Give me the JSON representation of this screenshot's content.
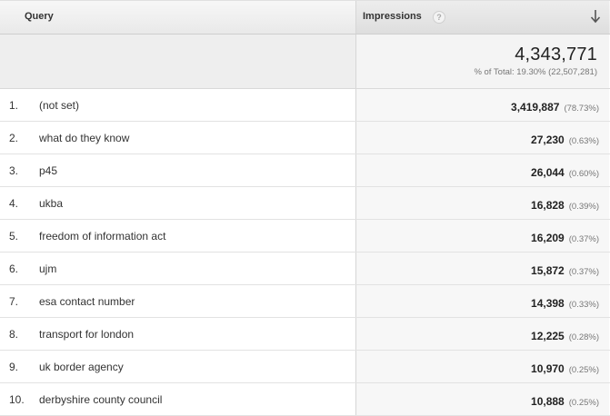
{
  "header": {
    "query_label": "Query",
    "impressions_label": "Impressions",
    "help_icon": "?",
    "sort_icon": "arrow-down-icon"
  },
  "totals": {
    "value": "4,343,771",
    "sub": "% of Total: 19.30% (22,507,281)"
  },
  "rows": [
    {
      "rank": "1.",
      "query": "(not set)",
      "value": "3,419,887",
      "pct": "(78.73%)"
    },
    {
      "rank": "2.",
      "query": "what do they know",
      "value": "27,230",
      "pct": "(0.63%)"
    },
    {
      "rank": "3.",
      "query": "p45",
      "value": "26,044",
      "pct": "(0.60%)"
    },
    {
      "rank": "4.",
      "query": "ukba",
      "value": "16,828",
      "pct": "(0.39%)"
    },
    {
      "rank": "5.",
      "query": "freedom of information act",
      "value": "16,209",
      "pct": "(0.37%)"
    },
    {
      "rank": "6.",
      "query": "ujm",
      "value": "15,872",
      "pct": "(0.37%)"
    },
    {
      "rank": "7.",
      "query": "esa contact number",
      "value": "14,398",
      "pct": "(0.33%)"
    },
    {
      "rank": "8.",
      "query": "transport for london",
      "value": "12,225",
      "pct": "(0.28%)"
    },
    {
      "rank": "9.",
      "query": "uk border agency",
      "value": "10,970",
      "pct": "(0.25%)"
    },
    {
      "rank": "10.",
      "query": "derbyshire county council",
      "value": "10,888",
      "pct": "(0.25%)"
    }
  ]
}
